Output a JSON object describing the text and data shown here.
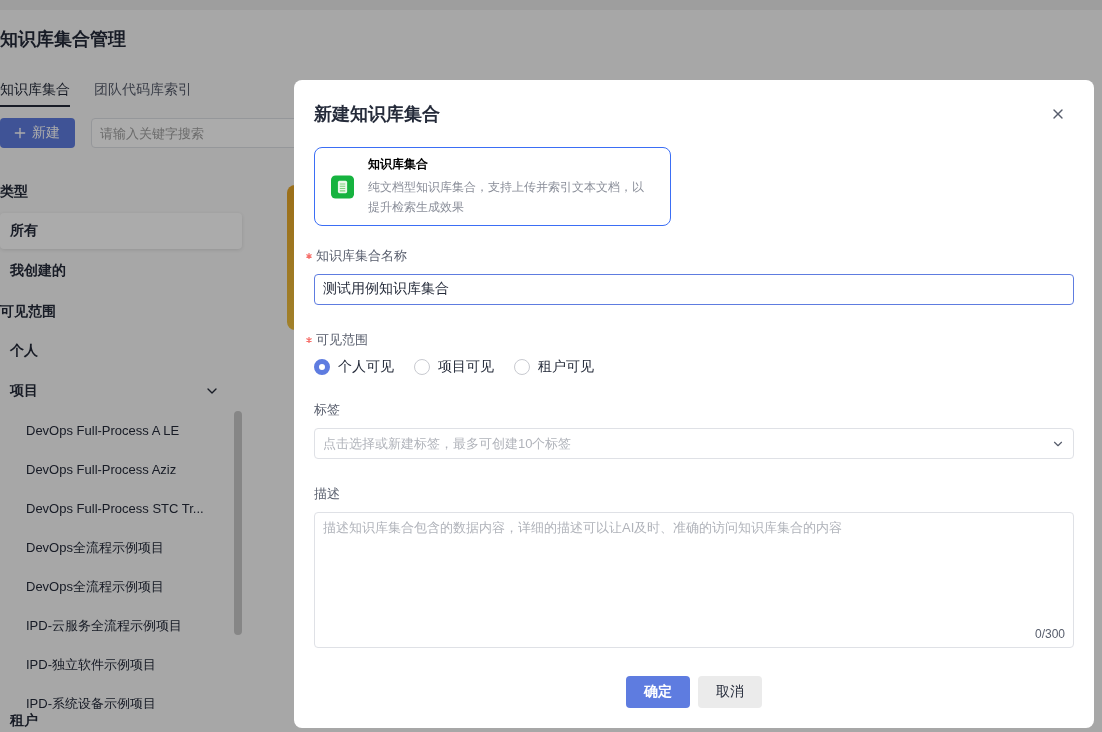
{
  "page": {
    "title": "知识库集合管理",
    "tabs": [
      {
        "label": "知识库集合",
        "selected": true
      },
      {
        "label": "团队代码库索引",
        "selected": false
      }
    ],
    "new_button": {
      "label": "新建"
    },
    "search": {
      "placeholder": "请输入关键字搜索"
    },
    "sidebar": [
      {
        "heading": "类型",
        "items": [
          {
            "label": "所有",
            "selected": true
          },
          {
            "label": "我创建的",
            "selected": false
          }
        ]
      },
      {
        "heading": "可见范围",
        "items": [
          {
            "label": "个人",
            "selected": false
          },
          {
            "label": "项目",
            "selected": false,
            "expanded": true,
            "children": [
              {
                "label": "DevOps Full-Process A LE",
                "selected": false
              },
              {
                "label": "DevOps Full-Process Aziz",
                "selected": false
              },
              {
                "label": "DevOps Full-Process STC Tr...",
                "selected": false
              },
              {
                "label": "DevOps全流程示例项目",
                "selected": false
              },
              {
                "label": "DevOps全流程示例项目",
                "selected": false
              },
              {
                "label": "IPD-云服务全流程示例项目",
                "selected": false
              },
              {
                "label": "IPD-独立软件示例项目",
                "selected": false
              },
              {
                "label": "IPD-系统设备示例项目",
                "selected": false
              }
            ]
          },
          {
            "label": "租户",
            "selected": false
          }
        ]
      }
    ]
  },
  "dialog": {
    "title": "新建知识库集合",
    "type_card": {
      "title": "知识库集合",
      "description": "纯文档型知识库集合，支持上传并索引文本文档，以提升检索生成效果",
      "selected": true
    },
    "name_field": {
      "label": "知识库集合名称",
      "required": true,
      "value": "测试用例知识库集合"
    },
    "visibility": {
      "label": "可见范围",
      "required": true,
      "options": [
        {
          "label": "个人可见",
          "selected": true
        },
        {
          "label": "项目可见",
          "selected": false
        },
        {
          "label": "租户可见",
          "selected": false
        }
      ]
    },
    "tags_field": {
      "label": "标签",
      "required": false,
      "placeholder": "点击选择或新建标签，最多可创建10个标签"
    },
    "description_field": {
      "label": "描述",
      "required": false,
      "placeholder": "描述知识库集合包含的数据内容，详细的描述可以让AI及时、准确的访问知识库集合的内容",
      "counter": "0/300"
    },
    "buttons": [
      {
        "label": "确定",
        "kind": "primary"
      },
      {
        "label": "取消",
        "kind": "secondary"
      }
    ]
  }
}
